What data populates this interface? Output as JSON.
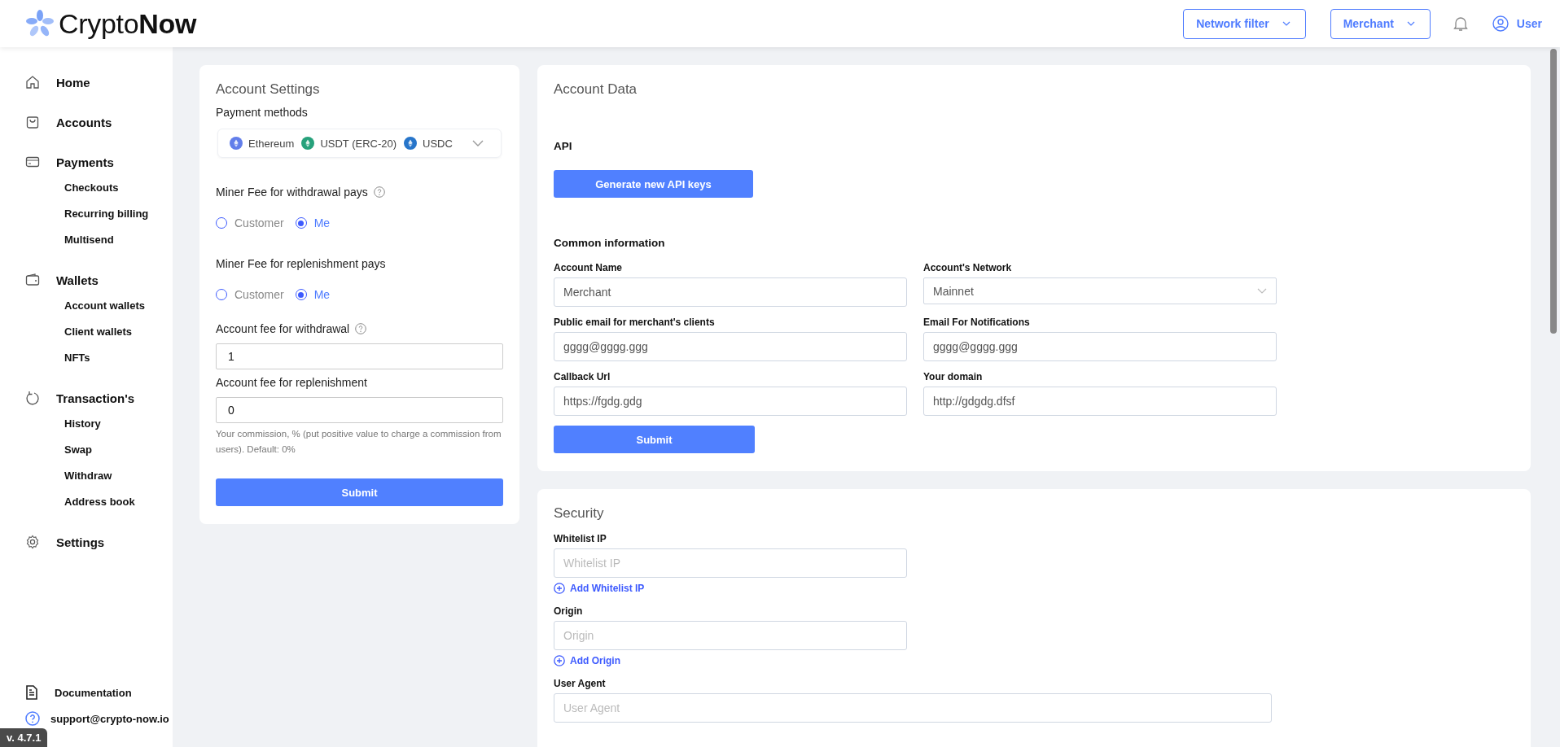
{
  "header": {
    "logo": "Crypto**Now**",
    "network_filter": "Network filter",
    "merchant": "Merchant",
    "user": "User"
  },
  "sidebar": {
    "items": [
      {
        "label": "Home"
      },
      {
        "label": "Accounts"
      },
      {
        "label": "Payments",
        "children": [
          {
            "label": "Checkouts"
          },
          {
            "label": "Recurring billing"
          },
          {
            "label": "Multisend"
          }
        ]
      },
      {
        "label": "Wallets",
        "children": [
          {
            "label": "Account wallets"
          },
          {
            "label": "Client wallets"
          },
          {
            "label": "NFTs"
          }
        ]
      },
      {
        "label": "Transaction's",
        "children": [
          {
            "label": "History"
          },
          {
            "label": "Swap"
          },
          {
            "label": "Withdraw"
          },
          {
            "label": "Address book"
          }
        ]
      },
      {
        "label": "Settings"
      }
    ],
    "footer": [
      {
        "label": "Documentation"
      },
      {
        "label": "support@crypto-now.io"
      }
    ],
    "version": "v. 4.7.1"
  },
  "account_settings": {
    "title": "Account Settings",
    "payment_methods_label": "Payment methods",
    "payment_methods": [
      {
        "name": "Ethereum",
        "color": "#627eea"
      },
      {
        "name": "USDT (ERC-20)",
        "color": "#26a17b"
      },
      {
        "name": "USDC",
        "color": "#2775ca"
      }
    ],
    "radio_groups": [
      {
        "label": "Miner Fee for withdrawal pays",
        "help": true,
        "options": [
          {
            "label": "Customer",
            "selected": false
          },
          {
            "label": "Me",
            "selected": true
          }
        ]
      },
      {
        "label": "Miner Fee for replenishment pays",
        "help": false,
        "options": [
          {
            "label": "Customer",
            "selected": false
          },
          {
            "label": "Me",
            "selected": true
          }
        ]
      }
    ],
    "fee_fields": [
      {
        "label": "Account fee for withdrawal",
        "help": true,
        "value": "1"
      },
      {
        "label": "Account fee for replenishment",
        "help": false,
        "value": "0"
      }
    ],
    "hint": "Your commission, % (put positive value to charge a commission from users). Default: 0%",
    "submit": "Submit"
  },
  "account_data": {
    "title": "Account Data",
    "api_heading": "API",
    "api_button": "Generate new API keys",
    "common_heading": "Common information",
    "fields": [
      {
        "label": "Account Name",
        "value": "Merchant",
        "kind": "input"
      },
      {
        "label": "Account's Network",
        "value": "Mainnet",
        "kind": "select"
      },
      {
        "label": "Public email for merchant's clients",
        "value": "gggg@gggg.ggg",
        "kind": "input"
      },
      {
        "label": "Email For Notifications",
        "value": "gggg@gggg.ggg",
        "kind": "input"
      },
      {
        "label": "Callback Url",
        "value": "https://fgdg.gdg",
        "kind": "input"
      },
      {
        "label": "Your domain",
        "value": "http://gdgdg.dfsf",
        "kind": "input"
      }
    ],
    "submit": "Submit"
  },
  "security": {
    "title": "Security",
    "fields": [
      {
        "label": "Whitelist IP",
        "placeholder": "Whitelist IP",
        "add": "Add Whitelist IP",
        "wide": false
      },
      {
        "label": "Origin",
        "placeholder": "Origin",
        "add": "Add Origin",
        "wide": false
      },
      {
        "label": "User Agent",
        "placeholder": "User Agent",
        "wide": true
      }
    ]
  }
}
